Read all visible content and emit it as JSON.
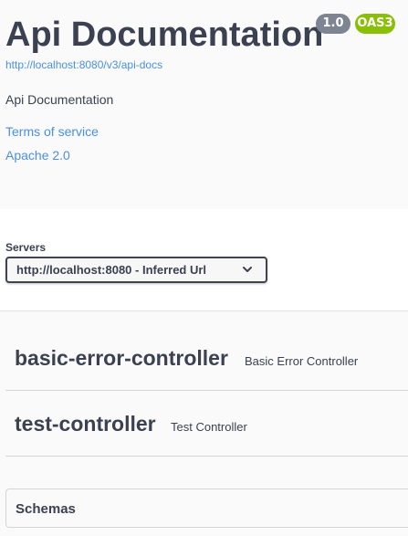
{
  "info": {
    "title": "Api Documentation",
    "version_badge": "1.0",
    "oas_badge": "OAS3",
    "spec_url": "http://localhost:8080/v3/api-docs",
    "description": "Api Documentation",
    "terms_of_service": "Terms of service",
    "license": "Apache 2.0"
  },
  "servers": {
    "label": "Servers",
    "selected": "http://localhost:8080 - Inferred Url",
    "chevron_icon": "chevron-down-icon"
  },
  "tags": [
    {
      "name": "basic-error-controller",
      "description": "Basic Error Controller"
    },
    {
      "name": "test-controller",
      "description": "Test Controller"
    }
  ],
  "schemas": {
    "title": "Schemas"
  },
  "colors": {
    "text": "#3b4151",
    "link": "#4990e2",
    "version_badge": "#7d8492",
    "oas_badge": "#89bf04"
  }
}
